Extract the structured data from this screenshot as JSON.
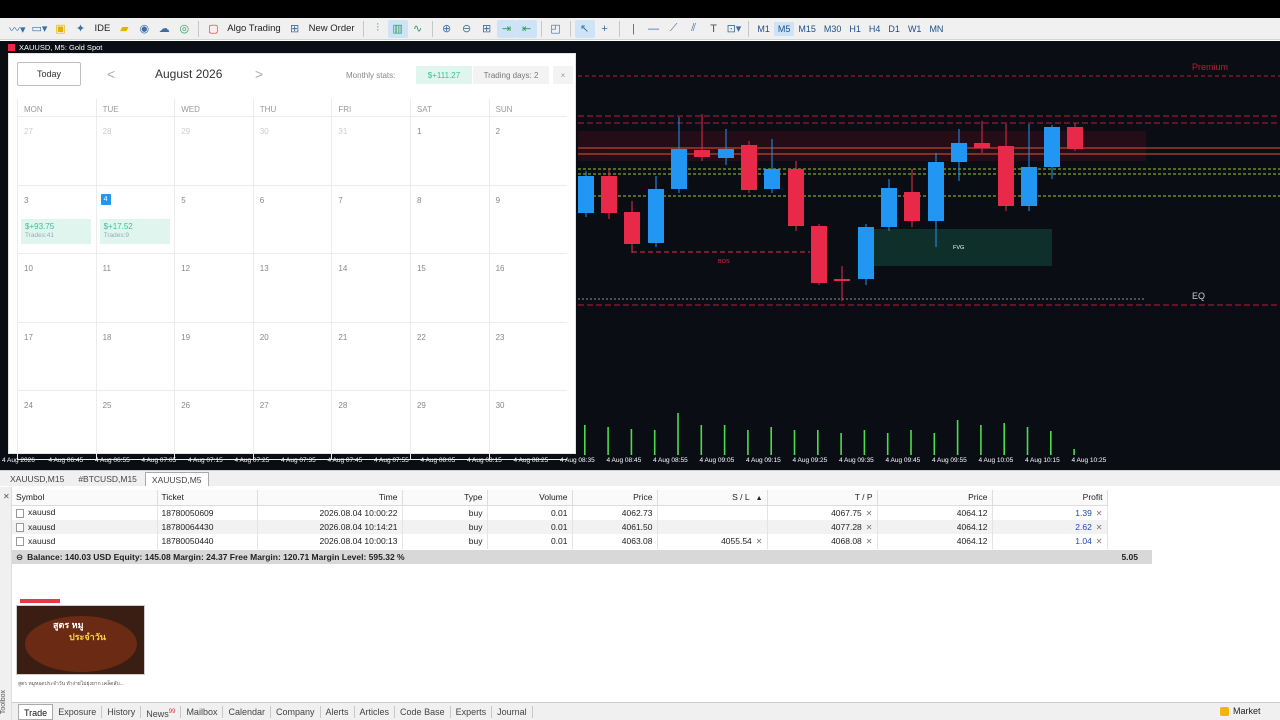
{
  "toolbar": {
    "ide_label": "IDE",
    "algo_label": "Algo Trading",
    "new_order_label": "New Order",
    "timeframes": [
      "M1",
      "M5",
      "M15",
      "M30",
      "H1",
      "H4",
      "D1",
      "W1",
      "MN"
    ],
    "active_timeframe": "M5"
  },
  "chart": {
    "title": "XAUUSD, M5:  Gold Spot",
    "labels": {
      "premium": "Premium",
      "eq": "EQ",
      "bos": "BOS",
      "fvg": "FVG"
    },
    "time_labels": [
      "4 Aug 2026",
      "4 Aug 06:45",
      "4 Aug 06:55",
      "4 Aug 07:05",
      "4 Aug 07:15",
      "4 Aug 07:25",
      "4 Aug 07:35",
      "4 Aug 07:45",
      "4 Aug 07:55",
      "4 Aug 08:05",
      "4 Aug 08:15",
      "4 Aug 08:25",
      "4 Aug 08:35",
      "4 Aug 08:45",
      "4 Aug 08:55",
      "4 Aug 09:05",
      "4 Aug 09:15",
      "4 Aug 09:25",
      "4 Aug 09:35",
      "4 Aug 09:45",
      "4 Aug 09:55",
      "4 Aug 10:05",
      "4 Aug 10:15",
      "4 Aug 10:25"
    ],
    "colors": {
      "bull": "#2196f3",
      "bear": "#e8294a",
      "volume": "#4cdd4c",
      "background": "#0b0d14"
    }
  },
  "calendar": {
    "today_label": "Today",
    "prev": "<",
    "next": ">",
    "month": "August 2026",
    "monthly_stats_label": "Monthly stats:",
    "monthly_stats_value": "$+111.27",
    "trading_days": "Trading days: 2",
    "close": "×",
    "weekdays": [
      "MON",
      "TUE",
      "WED",
      "THU",
      "FRI",
      "SAT",
      "SUN"
    ],
    "weeks": [
      [
        {
          "d": "27",
          "m": true
        },
        {
          "d": "28",
          "m": true
        },
        {
          "d": "29",
          "m": true
        },
        {
          "d": "30",
          "m": true
        },
        {
          "d": "31",
          "m": true
        },
        {
          "d": "1"
        },
        {
          "d": "2"
        }
      ],
      [
        {
          "d": "3",
          "pnl": "$+93.75",
          "trades": "Trades:41"
        },
        {
          "d": "4",
          "today": true,
          "pnl": "$+17.52",
          "trades": "Trades:9"
        },
        {
          "d": "5"
        },
        {
          "d": "6"
        },
        {
          "d": "7"
        },
        {
          "d": "8"
        },
        {
          "d": "9"
        }
      ],
      [
        {
          "d": "10"
        },
        {
          "d": "11"
        },
        {
          "d": "12"
        },
        {
          "d": "13"
        },
        {
          "d": "14"
        },
        {
          "d": "15"
        },
        {
          "d": "16"
        }
      ],
      [
        {
          "d": "17"
        },
        {
          "d": "18"
        },
        {
          "d": "19"
        },
        {
          "d": "20"
        },
        {
          "d": "21"
        },
        {
          "d": "22"
        },
        {
          "d": "23"
        }
      ],
      [
        {
          "d": "24"
        },
        {
          "d": "25"
        },
        {
          "d": "26"
        },
        {
          "d": "27"
        },
        {
          "d": "28"
        },
        {
          "d": "29"
        },
        {
          "d": "30"
        }
      ]
    ]
  },
  "chart_tabs": [
    "XAUUSD,M15",
    "#BTCUSD,M15",
    "XAUUSD,M5"
  ],
  "trade": {
    "columns": [
      "Symbol",
      "Ticket",
      "Time",
      "Type",
      "Volume",
      "Price",
      "S / L",
      "T / P",
      "Price",
      "Profit"
    ],
    "rows": [
      {
        "symbol": "xauusd",
        "ticket": "18780050609",
        "time": "2026.08.04 10:00:22",
        "type": "buy",
        "volume": "0.01",
        "price": "4062.73",
        "sl": "",
        "tp": "4067.75",
        "cur": "4064.12",
        "profit": "1.39"
      },
      {
        "symbol": "xauusd",
        "ticket": "18780064430",
        "time": "2026.08.04 10:14:21",
        "type": "buy",
        "volume": "0.01",
        "price": "4061.50",
        "sl": "",
        "tp": "4077.28",
        "cur": "4064.12",
        "profit": "2.62"
      },
      {
        "symbol": "xauusd",
        "ticket": "18780050440",
        "time": "2026.08.04 10:00:13",
        "type": "buy",
        "volume": "0.01",
        "price": "4063.08",
        "sl": "4055.54",
        "tp": "4068.08",
        "cur": "4064.12",
        "profit": "1.04"
      }
    ],
    "balance_line": "Balance: 140.03 USD  Equity: 145.08  Margin: 24.37  Free Margin: 120.71  Margin Level: 595.32 %",
    "total_profit": "5.05"
  },
  "thumbnail": {
    "title": "สูตร หมู",
    "subtitle": "ประจำวัน",
    "caption": "สูตร หมูทอดประจำวัน ทำง่ายไม่ยุ่งยาก เคล็ดลับ..."
  },
  "side_label": "Toolbox",
  "bottom_tabs": [
    "Trade",
    "Exposure",
    "History",
    "News",
    "Mailbox",
    "Calendar",
    "Company",
    "Alerts",
    "Articles",
    "Code Base",
    "Experts",
    "Journal"
  ],
  "news_badge": "99",
  "market_label": "Market"
}
